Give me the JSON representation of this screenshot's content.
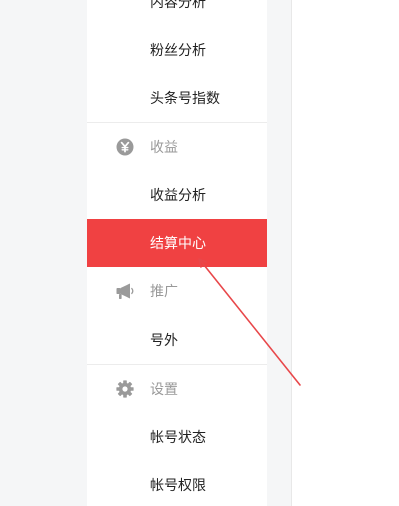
{
  "sidebar": {
    "items": [
      {
        "label": "内容分析"
      },
      {
        "label": "粉丝分析"
      },
      {
        "label": "头条号指数"
      }
    ],
    "sections": [
      {
        "title": "收益",
        "icon": "yen-coin-icon",
        "items": [
          {
            "label": "收益分析"
          },
          {
            "label": "结算中心",
            "active": true
          }
        ]
      },
      {
        "title": "推广",
        "icon": "megaphone-icon",
        "items": [
          {
            "label": "号外"
          }
        ]
      },
      {
        "title": "设置",
        "icon": "gear-icon",
        "items": [
          {
            "label": "帐号状态"
          },
          {
            "label": "帐号权限"
          }
        ]
      }
    ]
  },
  "colors": {
    "accent": "#f04142",
    "section_text": "#999999",
    "item_text": "#222222",
    "background": "#f5f6f7",
    "annotation_arrow": "#e8474a"
  }
}
